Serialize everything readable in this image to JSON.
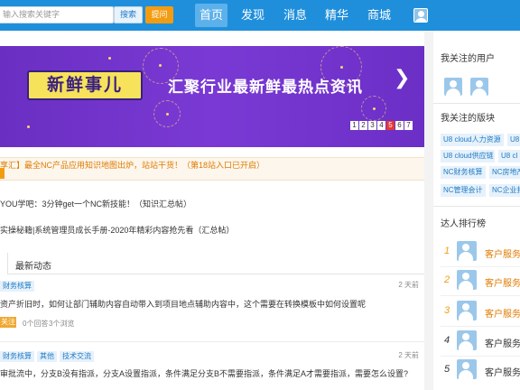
{
  "header": {
    "search_placeholder": "输入搜索关键字",
    "search_button": "搜索",
    "ask_button": "提问",
    "nav": [
      {
        "label": "首页",
        "active": true
      },
      {
        "label": "发现",
        "active": false
      },
      {
        "label": "消息",
        "active": false
      },
      {
        "label": "精华",
        "active": false
      },
      {
        "label": "商城",
        "active": false
      }
    ],
    "colors": {
      "bar": "#1f8fdb",
      "active": "#5db1ea",
      "ask": "#f39c12"
    }
  },
  "banner": {
    "badge": "新鲜事儿",
    "headline": "汇聚行业最新鲜最热点资讯",
    "next_icon": "chevron-right-icon",
    "pages": [
      "1",
      "2",
      "3",
      "4",
      "5",
      "6",
      "7"
    ],
    "current_page": "5"
  },
  "notice": {
    "text": "享汇】最全NC产品应用知识地图出炉，站站干货！（第18站入口已开启）"
  },
  "links": [
    "YOU学吧：3分钟get一个NC新技能！（知识汇总帖）",
    "实操秘籍|系统管理员成长手册-2020年精彩内容抢先看（汇总帖）"
  ],
  "tabs": {
    "latest": "最新动态"
  },
  "feed": [
    {
      "tags": [
        "财务核算"
      ],
      "time": "2 天前",
      "title": "资产折旧时，如何让部门辅助内容自动带入到项目地点辅助内容中，这个需要在转换模板中如何设置呢",
      "follow": "关注",
      "answers": "0个回答",
      "views": "3个浏览"
    },
    {
      "tags": [
        "财务核算",
        "其他",
        "技术交流"
      ],
      "time": "2 天前",
      "title": "审批流中，分支B没有指派，分支A设置指派，条件满足分支B不需要指派，条件满足A才需要指派，需要怎么设置?"
    }
  ],
  "sidebar": {
    "followed_users_title": "我关注的用户",
    "followed_boards_title": "我关注的版块",
    "boards": [
      "U8 cloud人力资源",
      "U8",
      "U8 cloud供应链",
      "U8 cl",
      "NC财务核算",
      "NC房地产",
      "NC管理会计",
      "NC企业报"
    ],
    "ranking_title": "达人排行榜",
    "ranking": [
      {
        "rank": "1",
        "name": "客户服务",
        "hot": true
      },
      {
        "rank": "2",
        "name": "客户服务",
        "hot": true
      },
      {
        "rank": "3",
        "name": "客户服务",
        "hot": true
      },
      {
        "rank": "4",
        "name": "客户服务",
        "hot": false
      },
      {
        "rank": "5",
        "name": "客户服务",
        "hot": false
      }
    ]
  }
}
